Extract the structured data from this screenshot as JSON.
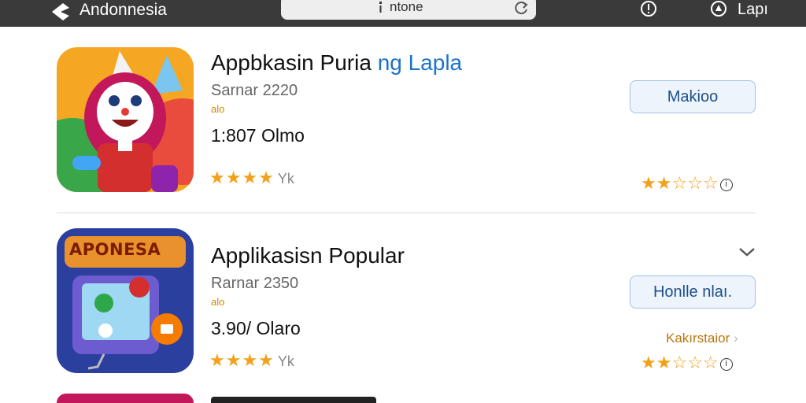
{
  "topbar": {
    "brand": "Andonnesia",
    "address": "ntone",
    "right_label": "Lapı"
  },
  "apps": [
    {
      "title_main": "Appbkasin Puria",
      "title_accent": "ng Lapla",
      "subtitle": "Sarnar  2220",
      "tag": "alo",
      "price": "1:807 Olmo",
      "stars": "★★★★",
      "rating_count": "Yk",
      "button_label": "Makioo",
      "right_rating": {
        "filled": "★★",
        "empty": "☆☆☆",
        "info": "i"
      }
    },
    {
      "title_main": "Applikasisn Popular",
      "title_accent": "",
      "subtitle": "Rarnar  2350",
      "tag": "alo",
      "price": "3.90/ Olaro",
      "stars": "★★★★",
      "rating_count": "Yk",
      "button_label": "Honlle nlaı.",
      "icon_banner": "APONESA",
      "status_link": "Kakırstaior",
      "right_rating": {
        "filled": "★★",
        "empty": "☆☆☆",
        "info": "i"
      }
    }
  ],
  "colors": {
    "topbar": "#3a3a3a",
    "accent_blue": "#1a73c9",
    "star": "#f3a11b",
    "button_border": "#9ec2e6"
  },
  "icons": [
    "back-icon",
    "lock-icon",
    "reload-icon",
    "info-icon",
    "account-icon",
    "chevron-down-icon"
  ]
}
